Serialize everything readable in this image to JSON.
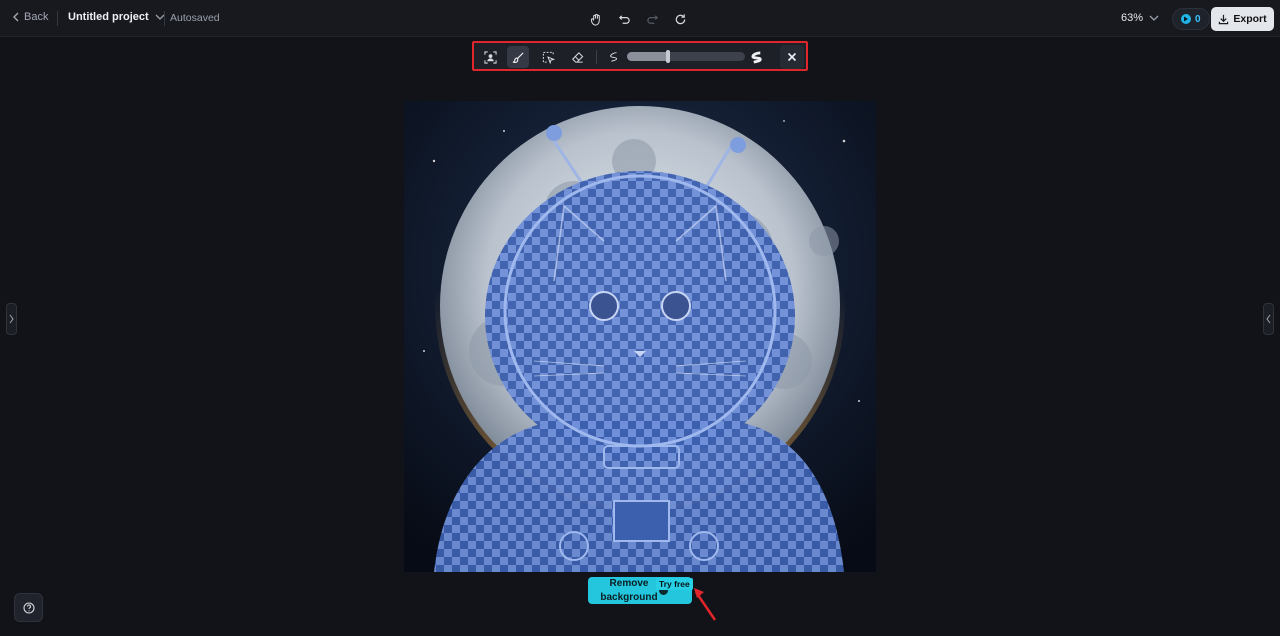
{
  "header": {
    "back_label": "Back",
    "project_title": "Untitled project",
    "autosave_status": "Autosaved",
    "zoom_level": "63%",
    "credits_count": "0",
    "export_label": "Export"
  },
  "toolbar_center": {
    "icons": [
      "hand-icon",
      "undo-icon",
      "redo-icon",
      "refresh-icon"
    ]
  },
  "brush_toolbar": {
    "tools": [
      "select-subject-icon",
      "brush-icon",
      "lasso-icon",
      "eraser-icon"
    ],
    "active_tool": "brush-icon",
    "brush_size_fraction": 0.35
  },
  "canvas": {
    "subject": "astronaut cat in front of the moon with transparent selection mask"
  },
  "actions": {
    "remove_background_label": "Remove background",
    "try_free_badge": "Try free"
  },
  "colors": {
    "accent": "#23c6dd",
    "highlight_box": "#e0262b",
    "background": "#111318"
  }
}
